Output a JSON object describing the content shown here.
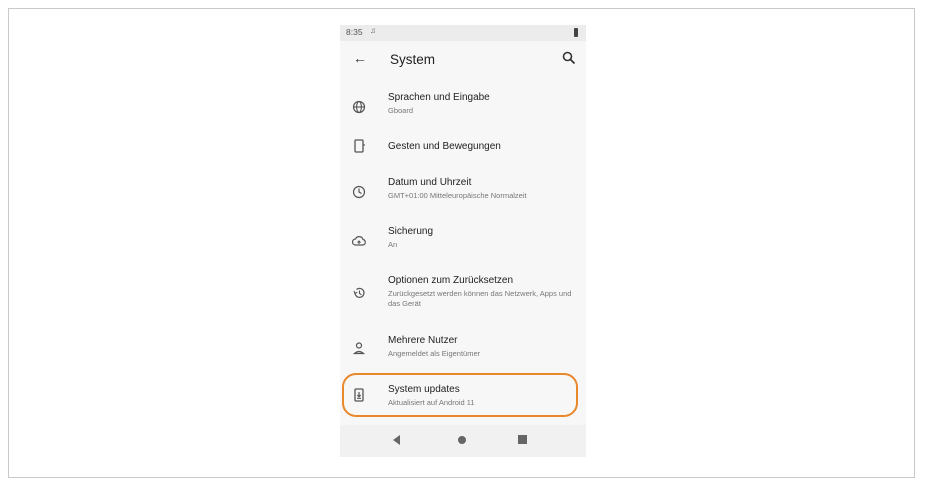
{
  "status_bar": {
    "time": "8:35"
  },
  "app_bar": {
    "title": "System"
  },
  "items": [
    {
      "icon": "globe-icon",
      "title": "Sprachen und Eingabe",
      "subtitle": "Gboard"
    },
    {
      "icon": "phone-gesture-icon",
      "title": "Gesten und Bewegungen",
      "subtitle": ""
    },
    {
      "icon": "clock-icon",
      "title": "Datum und Uhrzeit",
      "subtitle": "GMT+01:00 Mitteleuropäische Normalzeit"
    },
    {
      "icon": "cloud-upload-icon",
      "title": "Sicherung",
      "subtitle": "An"
    },
    {
      "icon": "restore-icon",
      "title": "Optionen zum Zurücksetzen",
      "subtitle": "Zurückgesetzt werden können das Netzwerk, Apps und das Gerät"
    },
    {
      "icon": "user-icon",
      "title": "Mehrere Nutzer",
      "subtitle": "Angemeldet als Eigentümer"
    },
    {
      "icon": "system-update-icon",
      "title": "System updates",
      "subtitle": "Aktualisiert auf Android 11"
    }
  ],
  "highlight_color": "#e8882b"
}
